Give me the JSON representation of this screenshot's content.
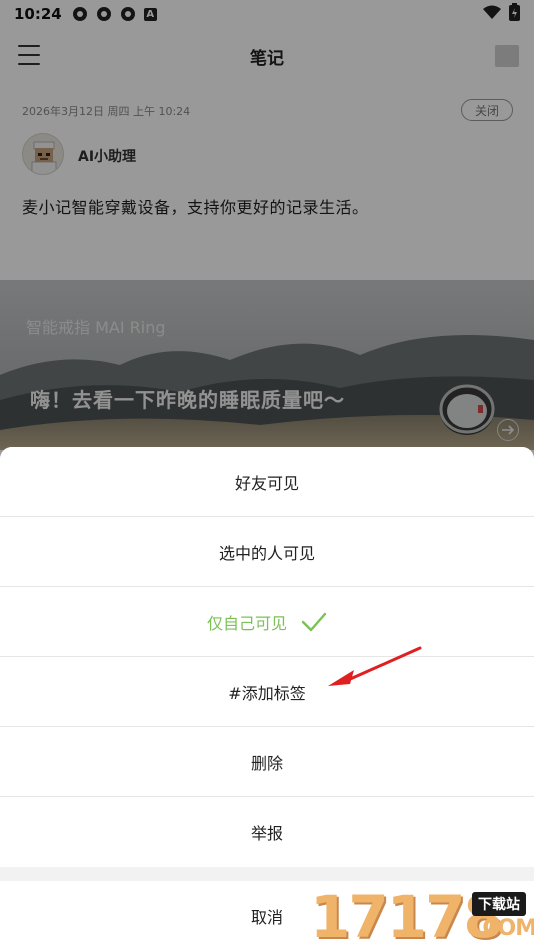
{
  "status_bar": {
    "time": "10:24",
    "notif_letter": "A"
  },
  "header": {
    "title": "笔记"
  },
  "note": {
    "date": "2026年3月12日 周四 上午 10:24",
    "close_label": "关闭",
    "author": "AI小助理",
    "content": "麦小记智能穿戴设备，支持你更好的记录生活。"
  },
  "banner": {
    "subtitle": "智能戒指 MAI Ring",
    "headline": "嗨！去看一下昨晚的睡眠质量吧～"
  },
  "sheet": {
    "items": [
      {
        "label": "好友可见"
      },
      {
        "label": "选中的人可见"
      },
      {
        "label": "仅自己可见",
        "selected": true
      },
      {
        "label": "#添加标签"
      },
      {
        "label": "删除"
      },
      {
        "label": "举报"
      }
    ],
    "cancel": "取消"
  },
  "colors": {
    "accent_green": "#7cc155",
    "annotation_red": "#e02020",
    "watermark_orange": "#f0b36a"
  },
  "watermark": {
    "digits": "17178",
    "tag": "下载站",
    "domain": ".COM"
  }
}
